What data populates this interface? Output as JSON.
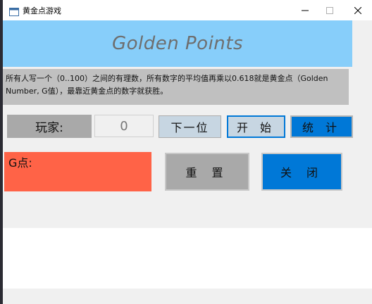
{
  "window": {
    "title": "黄金点游戏",
    "icon": "app-window-icon",
    "controls": [
      "minimize-icon",
      "maximize-icon",
      "close-icon"
    ]
  },
  "banner": {
    "title": "Golden Points"
  },
  "description": "所有人写一个（0..100）之间的有理数，所有数字的平均值再乘以0.618就是黄金点（Golden Number, G值），最靠近黄金点的数字就获胜。",
  "player": {
    "label": "玩家:",
    "value": "0"
  },
  "buttons": {
    "next": "下一位",
    "start": "开 始",
    "stats": "统 计",
    "reset": "重 置",
    "close": "关 闭"
  },
  "g_point": {
    "label": "G点:"
  },
  "colors": {
    "banner": "#87cefa",
    "description": "#c0c0c0",
    "g_box": "#ff6347",
    "accent": "#0078d7",
    "gray_button": "#a9a9a9",
    "light_button": "#c7d6e2"
  }
}
